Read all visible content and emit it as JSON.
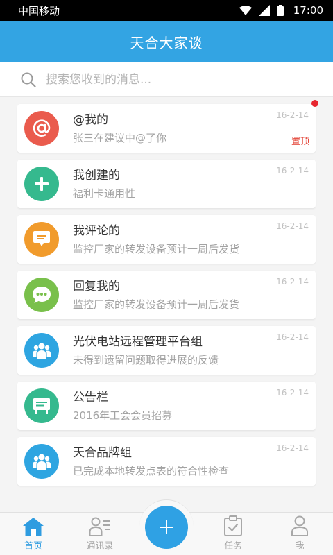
{
  "status_bar": {
    "carrier": "中国移动",
    "time": "17:00"
  },
  "header": {
    "title": "天合大家谈"
  },
  "search": {
    "placeholder": "搜索您收到的消息..."
  },
  "messages": [
    {
      "title": "@我的",
      "subtitle": "张三在建议中@了你",
      "date": "16-2-14",
      "pin_label": "置顶",
      "icon": "at-icon",
      "color": "#ea5b4d",
      "unread": true
    },
    {
      "title": "我创建的",
      "subtitle": "福利卡通用性",
      "date": "16-2-14",
      "icon": "plus-icon",
      "color": "#35b98e"
    },
    {
      "title": "我评论的",
      "subtitle": "监控厂家的转发设备预计一周后发货",
      "date": "16-2-14",
      "icon": "comment-icon",
      "color": "#f19b2c"
    },
    {
      "title": "回复我的",
      "subtitle": "监控厂家的转发设备预计一周后发货",
      "date": "16-2-14",
      "icon": "chat-bubble-icon",
      "color": "#79c04b"
    },
    {
      "title": "光伏电站远程管理平台组",
      "subtitle": "未得到遗留问题取得进展的反馈",
      "date": "16-2-14",
      "icon": "group-icon",
      "color": "#2ea5e1"
    },
    {
      "title": "公告栏",
      "subtitle": "2016年工会会员招募",
      "date": "16-2-14",
      "icon": "bulletin-board-icon",
      "color": "#35b98e"
    },
    {
      "title": "天合品牌组",
      "subtitle": "已完成本地转发点表的符合性检查",
      "date": "16-2-14",
      "icon": "group-icon",
      "color": "#2ea5e1"
    }
  ],
  "tabs": [
    {
      "label": "首页",
      "icon": "home-icon",
      "active": true
    },
    {
      "label": "通讯录",
      "icon": "contacts-icon"
    },
    {
      "label": "任务",
      "icon": "task-clipboard-icon"
    },
    {
      "label": "我",
      "icon": "person-icon"
    }
  ],
  "fab": {
    "icon": "plus-icon"
  },
  "colors": {
    "primary": "#33a4e3",
    "active_tab": "#2f9ce0",
    "unread": "#e7262f",
    "pin": "#e23b2e"
  }
}
